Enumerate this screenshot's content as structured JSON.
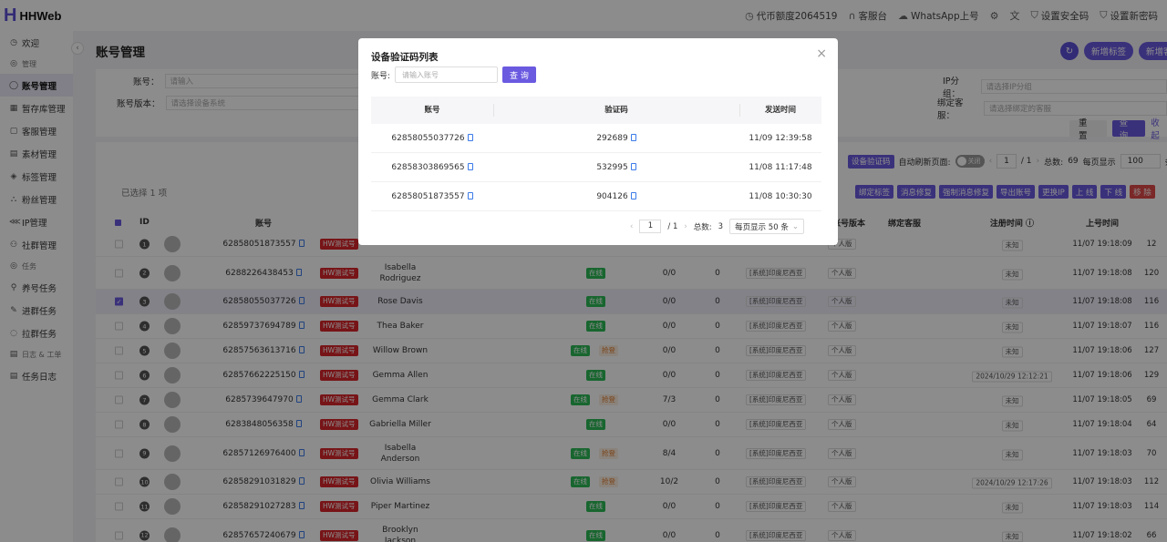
{
  "app": {
    "logo_mark": "H",
    "name": "HHWeb"
  },
  "header": {
    "items": [
      {
        "icon": "◷",
        "label": "代币额度2064519"
      },
      {
        "icon": "∩",
        "label": "客服台"
      },
      {
        "icon": "☁",
        "label": "WhatsApp上号"
      },
      {
        "icon": "⚙",
        "label": ""
      },
      {
        "icon": "文",
        "label": ""
      },
      {
        "icon": "⛉",
        "label": "设置安全码"
      },
      {
        "icon": "⛉",
        "label": "设置新密码"
      }
    ]
  },
  "sidebar": {
    "items": [
      {
        "type": "item",
        "icon": "◷",
        "label": "欢迎"
      },
      {
        "type": "group",
        "icon": "◎",
        "label": "管理"
      },
      {
        "type": "item",
        "icon": "◯",
        "label": "账号管理",
        "active": true
      },
      {
        "type": "item",
        "icon": "▦",
        "label": "暂存库管理"
      },
      {
        "type": "item",
        "icon": "▢",
        "label": "客服管理"
      },
      {
        "type": "item",
        "icon": "▤",
        "label": "素材管理"
      },
      {
        "type": "item",
        "icon": "◈",
        "label": "标签管理"
      },
      {
        "type": "item",
        "icon": "⛬",
        "label": "粉丝管理"
      },
      {
        "type": "item",
        "icon": "⋘",
        "label": "IP管理"
      },
      {
        "type": "item",
        "icon": "⚇",
        "label": "社群管理"
      },
      {
        "type": "group",
        "icon": "◎",
        "label": "任务"
      },
      {
        "type": "item",
        "icon": "⚲",
        "label": "养号任务"
      },
      {
        "type": "item",
        "icon": "✎",
        "label": "进群任务"
      },
      {
        "type": "item",
        "icon": "◌",
        "label": "拉群任务"
      },
      {
        "type": "group",
        "icon": "▤",
        "label": "日志 & 工单"
      },
      {
        "type": "item",
        "icon": "▤",
        "label": "任务日志"
      }
    ]
  },
  "page": {
    "title": "账号管理",
    "top_buttons": [
      "新增标签",
      "新增客"
    ],
    "refresh_icon": "↻"
  },
  "filters": {
    "account_label": "账号：",
    "account_placeholder": "请输入",
    "version_label": "账号版本：",
    "version_placeholder": "请选择设备系统",
    "ip_group_label": "IP分组：",
    "ip_group_placeholder": "请选择IP分组",
    "agent_label": "绑定客服：",
    "agent_placeholder": "请选择绑定的客服",
    "reset": "重 置",
    "search": "查 询",
    "collapse": "收起"
  },
  "toolbar": {
    "verify_btn": "设备验证码",
    "auto_refresh_label": "自动刷新页面:",
    "toggle_text": "关闭",
    "page": "1",
    "page_total": "/ 1",
    "total_label": "总数:",
    "total": "69",
    "per_page_label": "每页显示",
    "per_page": "100",
    "per_page_suffix": "条",
    "actions": [
      "绑定标签",
      "消息修复",
      "强制消息修复",
      "导出账号",
      "更换IP",
      "上 线",
      "下 线",
      "移 除"
    ],
    "selected_text": "已选择 1 项"
  },
  "table": {
    "headers": {
      "id": "ID",
      "account": "账号",
      "version": "账号版本",
      "agent": "绑定客服",
      "reg_time": "注册时间 ⓘ",
      "login_time": "上号时间"
    },
    "rows": [
      {
        "id": "1",
        "account": "62858051873557",
        "tag": "HW测试号",
        "name": "",
        "status": "",
        "grab": "",
        "ratio": "",
        "zero": "",
        "sys": "",
        "ver": "个人版",
        "reg": "未知",
        "up": "11/07 19:18:09",
        "last": "12",
        "tall": false,
        "sel": false
      },
      {
        "id": "2",
        "account": "6288226438453",
        "tag": "HW测试号",
        "name": "Isabella Rodriguez",
        "status": "在线",
        "grab": "",
        "ratio": "0/0",
        "zero": "0",
        "sys": "[系统]印度尼西亚",
        "ver": "个人版",
        "reg": "未知",
        "up": "11/07 19:18:08",
        "last": "120",
        "tall": true,
        "sel": false
      },
      {
        "id": "3",
        "account": "62858055037726",
        "tag": "HW测试号",
        "name": "Rose Davis",
        "status": "在线",
        "grab": "",
        "ratio": "0/0",
        "zero": "0",
        "sys": "[系统]印度尼西亚",
        "ver": "个人版",
        "reg": "未知",
        "up": "11/07 19:18:08",
        "last": "116",
        "tall": false,
        "sel": true
      },
      {
        "id": "4",
        "account": "62859737694789",
        "tag": "HW测试号",
        "name": "Thea Baker",
        "status": "在线",
        "grab": "",
        "ratio": "0/0",
        "zero": "0",
        "sys": "[系统]印度尼西亚",
        "ver": "个人版",
        "reg": "未知",
        "up": "11/07 19:18:07",
        "last": "116",
        "tall": false,
        "sel": false
      },
      {
        "id": "5",
        "account": "62857563613716",
        "tag": "HW测试号",
        "name": "Willow Brown",
        "status": "在线",
        "grab": "抢登",
        "ratio": "0/0",
        "zero": "0",
        "sys": "[系统]印度尼西亚",
        "ver": "个人版",
        "reg": "未知",
        "up": "11/07 19:18:06",
        "last": "127",
        "tall": false,
        "sel": false
      },
      {
        "id": "6",
        "account": "62857662225150",
        "tag": "HW测试号",
        "name": "Gemma Allen",
        "status": "在线",
        "grab": "",
        "ratio": "0/0",
        "zero": "0",
        "sys": "[系统]印度尼西亚",
        "ver": "个人版",
        "reg": "2024/10/29 12:12:21",
        "up": "11/07 19:18:06",
        "last": "129",
        "tall": false,
        "sel": false
      },
      {
        "id": "7",
        "account": "6285739647970",
        "tag": "HW测试号",
        "name": "Gemma Clark",
        "status": "在线",
        "grab": "抢登",
        "ratio": "7/3",
        "zero": "0",
        "sys": "[系统]印度尼西亚",
        "ver": "个人版",
        "reg": "未知",
        "up": "11/07 19:18:05",
        "last": "69",
        "tall": false,
        "sel": false
      },
      {
        "id": "8",
        "account": "6283848056358",
        "tag": "HW测试号",
        "name": "Gabriella Miller",
        "status": "在线",
        "grab": "",
        "ratio": "0/0",
        "zero": "0",
        "sys": "[系统]印度尼西亚",
        "ver": "个人版",
        "reg": "未知",
        "up": "11/07 19:18:04",
        "last": "64",
        "tall": false,
        "sel": false
      },
      {
        "id": "9",
        "account": "62857126976400",
        "tag": "HW测试号",
        "name": "Isabella Anderson",
        "status": "在线",
        "grab": "抢登",
        "ratio": "8/4",
        "zero": "0",
        "sys": "[系统]印度尼西亚",
        "ver": "个人版",
        "reg": "未知",
        "up": "11/07 19:18:03",
        "last": "70",
        "tall": true,
        "sel": false
      },
      {
        "id": "10",
        "account": "62858291031829",
        "tag": "HW测试号",
        "name": "Olivia Williams",
        "status": "在线",
        "grab": "抢登",
        "ratio": "10/2",
        "zero": "0",
        "sys": "[系统]印度尼西亚",
        "ver": "个人版",
        "reg": "2024/10/29 12:17:26",
        "up": "11/07 19:18:03",
        "last": "112",
        "tall": false,
        "sel": false
      },
      {
        "id": "11",
        "account": "62858291027283",
        "tag": "HW测试号",
        "name": "Piper Martinez",
        "status": "在线",
        "grab": "",
        "ratio": "0/0",
        "zero": "0",
        "sys": "[系统]印度尼西亚",
        "ver": "个人版",
        "reg": "未知",
        "up": "11/07 19:18:03",
        "last": "114",
        "tall": false,
        "sel": false
      },
      {
        "id": "12",
        "account": "62857657240679",
        "tag": "HW测试号",
        "name": "Brooklyn Jackson",
        "status": "在线",
        "grab": "",
        "ratio": "0/0",
        "zero": "0",
        "sys": "[系统]印度尼西亚",
        "ver": "个人版",
        "reg": "未知",
        "up": "11/07 19:18:02",
        "last": "66",
        "tall": true,
        "sel": false
      }
    ]
  },
  "modal": {
    "title": "设备验证码列表",
    "close": "×",
    "search_label": "账号:",
    "search_placeholder": "请输入账号",
    "search_btn": "查 询",
    "headers": {
      "account": "账号",
      "code": "验证码",
      "time": "发送时间"
    },
    "rows": [
      {
        "account": "62858055037726",
        "code": "292689",
        "time": "11/09 12:39:58"
      },
      {
        "account": "62858303869565",
        "code": "532995",
        "time": "11/08 11:17:48"
      },
      {
        "account": "62858051873557",
        "code": "904126",
        "time": "11/08 10:30:30"
      }
    ],
    "pager": {
      "prev": "‹",
      "page": "1",
      "page_total": "/ 1",
      "next": "›",
      "total_label": "总数:",
      "total": "3",
      "page_size": "每页显示 50 条",
      "dropdown": "⌄"
    }
  }
}
